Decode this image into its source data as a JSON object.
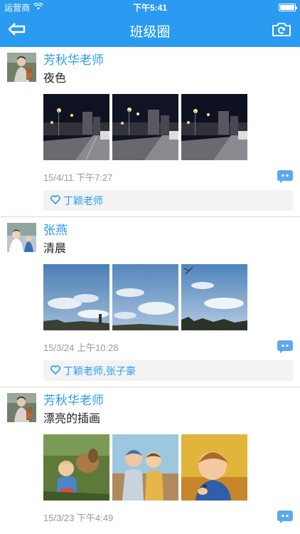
{
  "status_bar": {
    "carrier": "运营商",
    "time": "下午5:41",
    "battery_level": 1.0
  },
  "nav": {
    "title": "班级圈",
    "back_icon": "back-arrow-icon",
    "camera_icon": "camera-icon"
  },
  "colors": {
    "accent": "#2a9bf0",
    "likes_bg": "#f3f3f3",
    "time_text": "#999999"
  },
  "posts": [
    {
      "author": "芳秋华老师",
      "content": "夜色",
      "time": "15/4/11  下午7:27",
      "likes": "丁颖老师",
      "photo_theme": "night-street"
    },
    {
      "author": "张燕",
      "content": "清晨",
      "time": "15/3/24  上午10:28",
      "likes": "丁颖老师,张子豪",
      "photo_theme": "morning-sky"
    },
    {
      "author": "芳秋华老师",
      "content": "漂亮的插画",
      "time": "15/3/23  下午4:49",
      "photo_theme": "illustrations"
    }
  ]
}
